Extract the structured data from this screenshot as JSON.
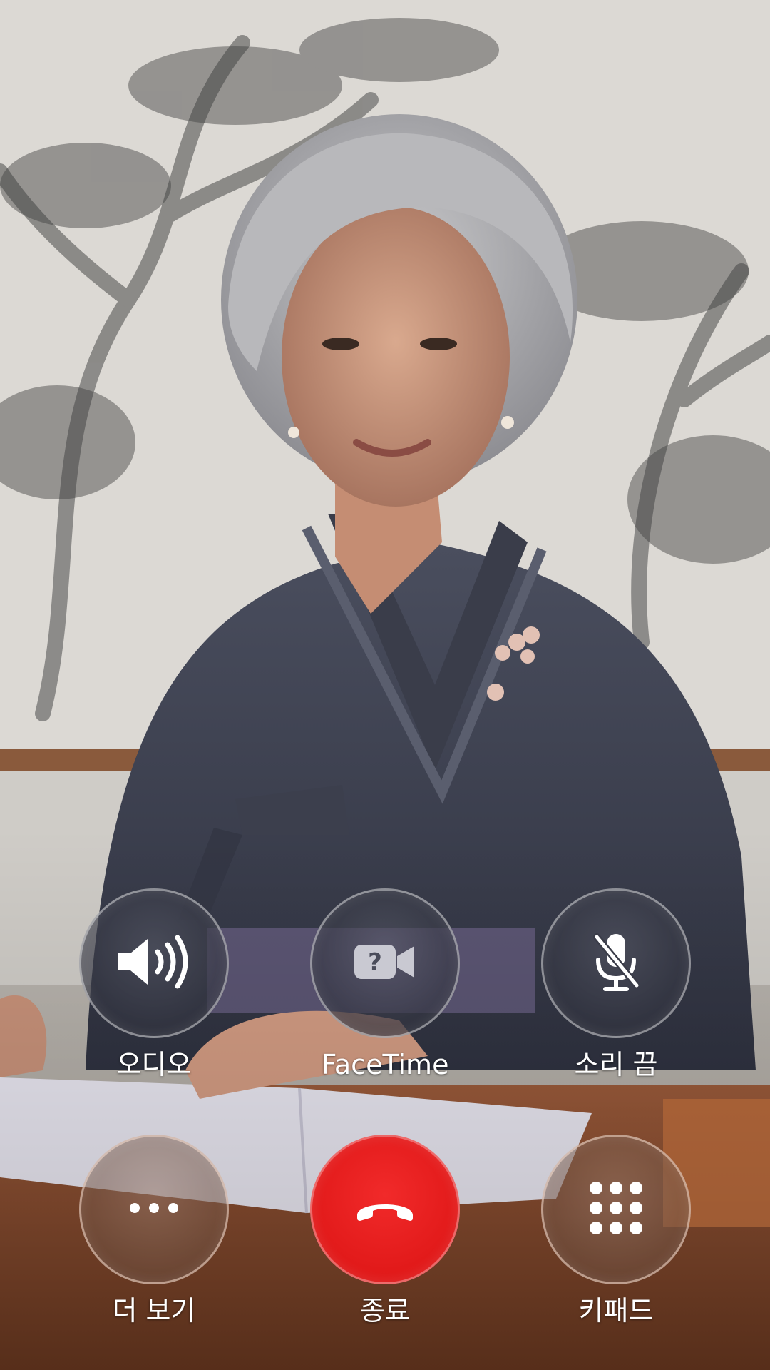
{
  "call_controls": {
    "row1": [
      {
        "label": "오디오",
        "icon": "speaker-icon"
      },
      {
        "label": "FaceTime",
        "icon": "facetime-unavailable-icon"
      },
      {
        "label": "소리 끔",
        "icon": "mic-muted-icon"
      }
    ],
    "row2": [
      {
        "label": "더 보기",
        "icon": "more-icon"
      },
      {
        "label": "종료",
        "icon": "end-call-icon"
      },
      {
        "label": "키패드",
        "icon": "keypad-icon"
      }
    ]
  },
  "colors": {
    "end_call": "#e01818",
    "icon_white": "#ffffff"
  }
}
